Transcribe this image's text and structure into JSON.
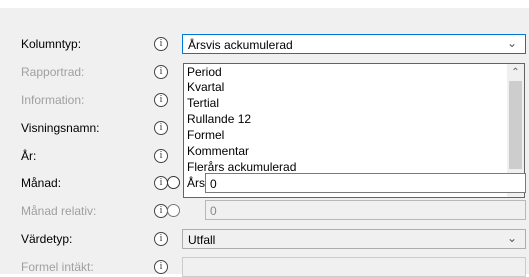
{
  "form": {
    "rows": [
      {
        "label": "Kolumntyp:",
        "enabled": true
      },
      {
        "label": "Rapportrad:",
        "enabled": false
      },
      {
        "label": "Information:",
        "enabled": false
      },
      {
        "label": "Visningsnamn:",
        "enabled": true
      },
      {
        "label": "År:",
        "enabled": true
      },
      {
        "label": "Månad:",
        "enabled": true
      },
      {
        "label": "Månad relativ:",
        "enabled": false
      },
      {
        "label": "Värdetyp:",
        "enabled": true
      },
      {
        "label": "Formel intäkt:",
        "enabled": false
      }
    ],
    "info_glyph": "i"
  },
  "kolumntyp": {
    "value": "Årsvis ackumulerad",
    "options": [
      "Period",
      "Kvartal",
      "Tertial",
      "Rullande 12",
      "Formel",
      "Kommentar",
      "Flerårs ackumulerad",
      "Årsoberoende total"
    ]
  },
  "manad": {
    "value": "0"
  },
  "manad_relativ": {
    "value": "0"
  },
  "vardetyp": {
    "value": "Utfall"
  },
  "icons": {
    "info": "info-circle-icon",
    "dropdown": "chevron-down-icon",
    "scroll_up": "chevron-up-icon",
    "scroll_down": "chevron-down-icon"
  }
}
